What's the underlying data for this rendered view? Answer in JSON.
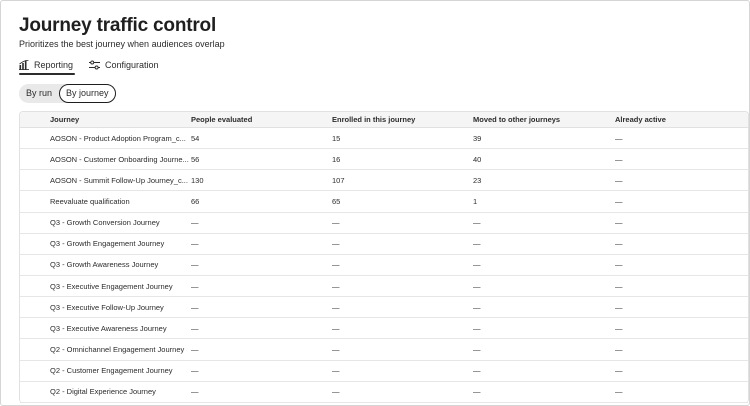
{
  "page": {
    "title": "Journey traffic control",
    "subtitle": "Prioritizes the best journey when audiences overlap"
  },
  "tabs": [
    {
      "label": "Reporting",
      "icon": "bar-chart-icon",
      "selected": true
    },
    {
      "label": "Configuration",
      "icon": "sliders-icon",
      "selected": false
    }
  ],
  "view_toggle": {
    "options": [
      {
        "label": "By run",
        "selected": false
      },
      {
        "label": "By journey",
        "selected": true
      }
    ]
  },
  "table": {
    "columns": [
      "Journey",
      "People evaluated",
      "Enrolled in this journey",
      "Moved to other journeys",
      "Already active"
    ],
    "rows": [
      [
        "AOSON - Product Adoption Program_c...",
        "54",
        "15",
        "39",
        "—"
      ],
      [
        "AOSON - Customer Onboarding Journe...",
        "56",
        "16",
        "40",
        "—"
      ],
      [
        "AOSON - Summit Follow-Up Journey_c...",
        "130",
        "107",
        "23",
        "—"
      ],
      [
        "Reevaluate qualification",
        "66",
        "65",
        "1",
        "—"
      ],
      [
        "Q3 - Growth Conversion Journey",
        "—",
        "—",
        "—",
        "—"
      ],
      [
        "Q3 - Growth Engagement Journey",
        "—",
        "—",
        "—",
        "—"
      ],
      [
        "Q3 - Growth Awareness Journey",
        "—",
        "—",
        "—",
        "—"
      ],
      [
        "Q3 - Executive Engagement Journey",
        "—",
        "—",
        "—",
        "—"
      ],
      [
        "Q3 - Executive Follow-Up Journey",
        "—",
        "—",
        "—",
        "—"
      ],
      [
        "Q3 - Executive Awareness Journey",
        "—",
        "—",
        "—",
        "—"
      ],
      [
        "Q2 - Omnichannel Engagement Journey",
        "—",
        "—",
        "—",
        "—"
      ],
      [
        "Q2 - Customer Engagement Journey",
        "—",
        "—",
        "—",
        "—"
      ],
      [
        "Q2 - Digital Experience Journey",
        "—",
        "—",
        "—",
        "—"
      ]
    ]
  }
}
